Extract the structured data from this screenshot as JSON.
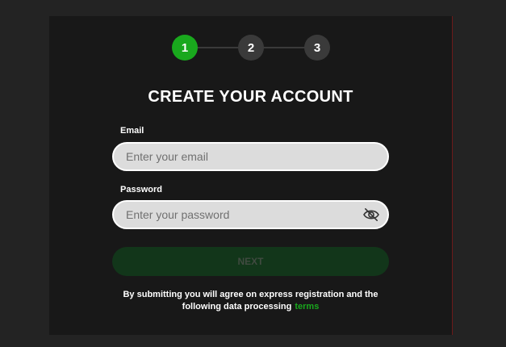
{
  "stepper": {
    "steps": [
      "1",
      "2",
      "3"
    ],
    "active_step": 1
  },
  "form": {
    "title": "CREATE YOUR ACCOUNT",
    "email": {
      "label": "Email",
      "placeholder": "Enter your email",
      "value": ""
    },
    "password": {
      "label": "Password",
      "placeholder": "Enter your password",
      "value": "",
      "visibility_icon": "eye-slash-icon"
    },
    "submit_label": "NEXT",
    "terms_text_line1": "By submitting you will agree on express registration and the",
    "terms_text_line2": "following data processing",
    "terms_link": "terms"
  },
  "colors": {
    "page_background": "#232323",
    "modal_background": "#181818",
    "accent_green": "#19a81d",
    "inactive_step": "#3a3a3a",
    "disabled_button": "#12361a",
    "field_background": "#dcdcdc"
  }
}
